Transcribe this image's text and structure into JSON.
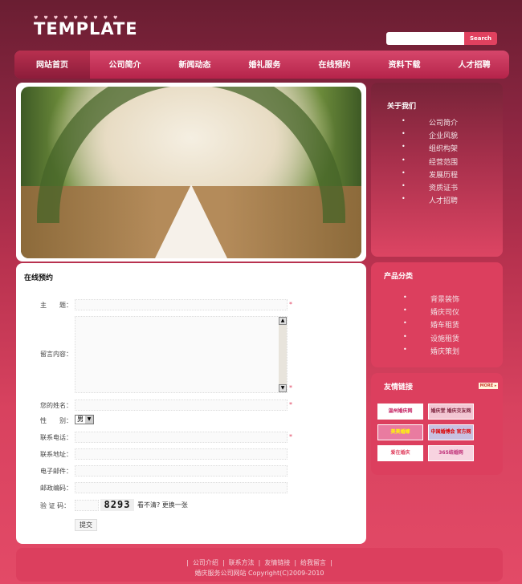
{
  "header": {
    "logo": "TEMPLATE",
    "search": {
      "placeholder": "",
      "value": "",
      "button": "Search"
    }
  },
  "nav": [
    {
      "label": "网站首页",
      "active": true
    },
    {
      "label": "公司简介"
    },
    {
      "label": "新闻动态"
    },
    {
      "label": "婚礼服务"
    },
    {
      "label": "在线预约"
    },
    {
      "label": "资料下载"
    },
    {
      "label": "人才招聘"
    }
  ],
  "form": {
    "title": "在线预约",
    "required_mark": "*",
    "fields": {
      "subject": "主　　题：",
      "content": "留言内容：",
      "name": "您的姓名：",
      "gender": "性　　别：",
      "phone": "联系电话：",
      "address": "联系地址：",
      "email": "电子邮件：",
      "zip": "邮政编码：",
      "captcha": "验 证 码："
    },
    "gender_value": "男",
    "captcha_code": "8293",
    "captcha_refresh": "看不清? 更换一张",
    "submit": "提交"
  },
  "sidebar": {
    "about": {
      "title": "关于我们",
      "items": [
        "公司简介",
        "企业风貌",
        "组织构架",
        "经营范围",
        "发展历程",
        "资质证书",
        "人才招聘"
      ]
    },
    "products": {
      "title": "产品分类",
      "items": [
        "背景装饰",
        "婚庆司仪",
        "婚车租赁",
        "设施租赁",
        "婚庆策划"
      ]
    },
    "links": {
      "title": "友情链接",
      "more": "MORE ▸",
      "banners": [
        "温州婚庆网 wzmarry.com",
        "婚庆堂 婚庆交友网站搜索",
        "美美婚嫁",
        "中国婚博会 官方网站",
        "爱在婚庆 wzmarry.com",
        "365结婚网"
      ]
    }
  },
  "footer": {
    "links": [
      "公司介绍",
      "联系方法",
      "友情链接",
      "给我留言"
    ],
    "copyright": "婚庆服务公司网站 Copyright(C)2009-2010"
  },
  "colors": {
    "accent": "#e0415f",
    "dark": "#6a1e32"
  }
}
